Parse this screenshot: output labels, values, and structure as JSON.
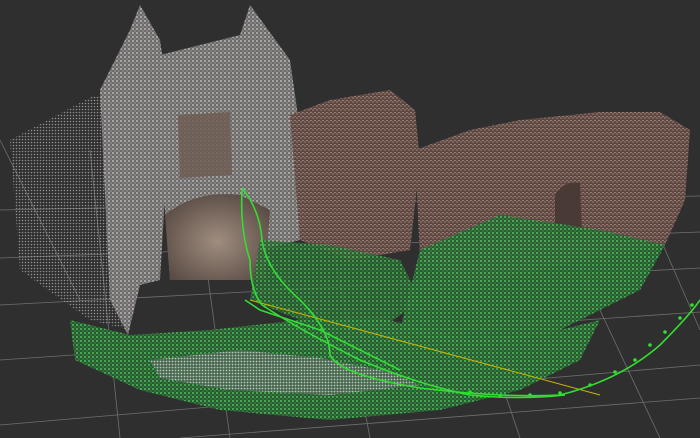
{
  "scene": {
    "background_color": "#2f2f2f",
    "grid_color": "#8a8a8a",
    "trajectory_color": "#33dd33",
    "axis_line_color": "#c8b400",
    "point_cloud_palette": {
      "stone_light": "#c9c7c4",
      "stone_blue": "#8fa2aa",
      "stone_brown": "#7a5e52",
      "stone_dark": "#4a3f3b",
      "moss": "#3f8f44",
      "grass": "#4ab257",
      "pale_path": "#c7d1cc"
    }
  }
}
